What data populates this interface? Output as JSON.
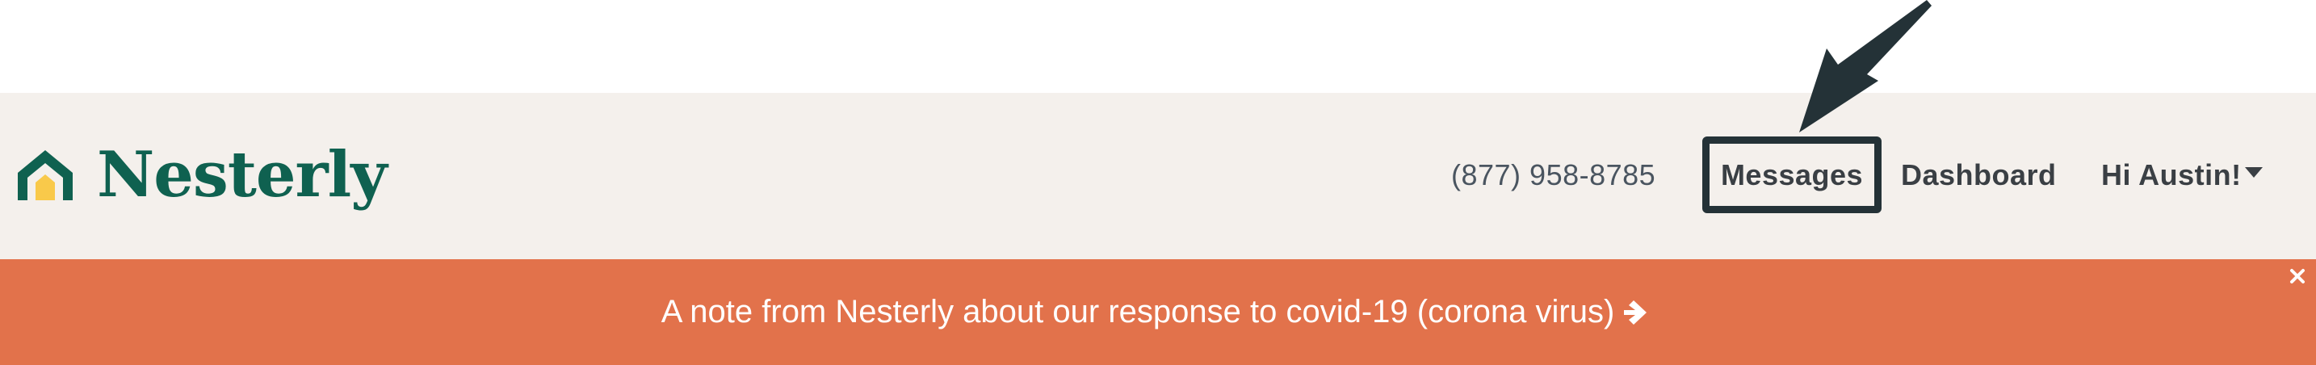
{
  "brand": {
    "name": "Nesterly",
    "color": "#0f6150",
    "accent": "#f9c94a"
  },
  "nav": {
    "phone": "(877) 958-8785",
    "messages_label": "Messages",
    "dashboard_label": "Dashboard",
    "user_greeting": "Hi Austin!"
  },
  "banner": {
    "text": "A note from Nesterly about our response to covid-19 (corona virus)",
    "color": "#e2724b",
    "arrow_icon": "arrow-right-icon",
    "close_icon": "close-icon"
  },
  "annotation": {
    "arrow_icon": "pointer-arrow-icon",
    "highlight_color": "#243237"
  }
}
